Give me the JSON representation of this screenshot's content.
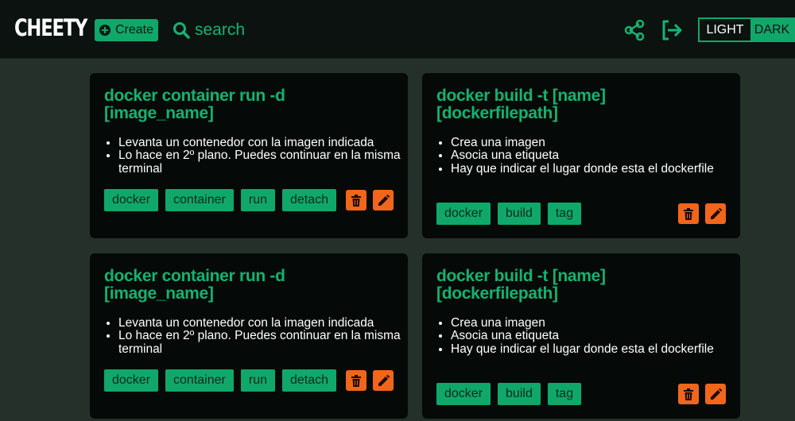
{
  "app": {
    "name": "CHEETY"
  },
  "header": {
    "create_label": "Create",
    "search_placeholder": "search",
    "icons": [
      "share-icon",
      "logout-icon"
    ],
    "theme": {
      "light_label": "LIGHT",
      "dark_label": "DARK",
      "selected": "LIGHT"
    }
  },
  "colors": {
    "accent": "#10a86a",
    "header_bg": "#0b1210",
    "page_bg": "#243029",
    "card_bg": "#050a08",
    "action": "#f2661c"
  },
  "cards": [
    {
      "title": "docker container run -d [image_name]",
      "items": [
        "Levanta un contenedor con la imagen indicada",
        "Lo hace en 2º plano. Puedes continuar en la misma terminal"
      ],
      "tags": [
        "docker",
        "container",
        "run",
        "detach"
      ]
    },
    {
      "title": "docker build -t [name] [dockerfilepath]",
      "items": [
        "Crea una imagen",
        "Asocia una etiqueta",
        "Hay que indicar el lugar donde esta el dockerfile"
      ],
      "tags": [
        "docker",
        "build",
        "tag"
      ]
    },
    {
      "title": "docker container run -d [image_name]",
      "items": [
        "Levanta un contenedor con la imagen indicada",
        "Lo hace en 2º plano. Puedes continuar en la misma terminal"
      ],
      "tags": [
        "docker",
        "container",
        "run",
        "detach"
      ]
    },
    {
      "title": "docker build -t [name] [dockerfilepath]",
      "items": [
        "Crea una imagen",
        "Asocia una etiqueta",
        "Hay que indicar el lugar donde esta el dockerfile"
      ],
      "tags": [
        "docker",
        "build",
        "tag"
      ]
    }
  ]
}
